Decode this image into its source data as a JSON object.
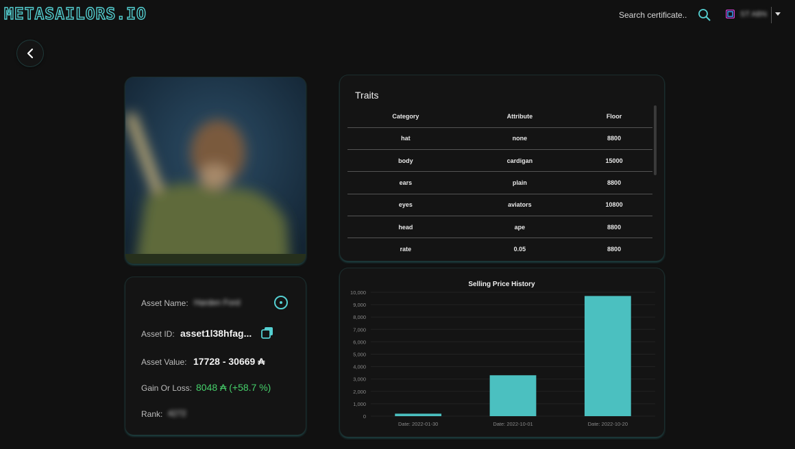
{
  "header": {
    "logo": "METASAILORS.IO",
    "search_placeholder": "Search certificate..",
    "wallet_name": "ST ABN"
  },
  "asset": {
    "name_label": "Asset Name:",
    "name_value": "Harden Ford",
    "id_label": "Asset ID:",
    "id_value": "asset1l38hfag...",
    "value_label": "Asset Value:",
    "value_value": "17728 - 30669 ₳",
    "gain_label": "Gain Or Loss:",
    "gain_value": "8048 ₳ (+58.7 %)",
    "rank_label": "Rank:",
    "rank_value": "4272"
  },
  "traits": {
    "title": "Traits",
    "columns": [
      "Category",
      "Attribute",
      "Floor"
    ],
    "rows": [
      [
        "hat",
        "none",
        "8800"
      ],
      [
        "body",
        "cardigan",
        "15000"
      ],
      [
        "ears",
        "plain",
        "8800"
      ],
      [
        "eyes",
        "aviators",
        "10800"
      ],
      [
        "head",
        "ape",
        "8800"
      ],
      [
        "rate",
        "0.05",
        "8800"
      ]
    ]
  },
  "chart_data": {
    "type": "bar",
    "title": "Selling Price History",
    "categories": [
      "Date: 2022-01-30",
      "Date: 2022-10-01",
      "Date: 2022-10-20"
    ],
    "values": [
      200,
      3300,
      9700
    ],
    "ylim": [
      0,
      10000
    ],
    "yticks": [
      "0",
      "1,000",
      "2,000",
      "3,000",
      "4,000",
      "5,000",
      "6,000",
      "7,000",
      "8,000",
      "9,000",
      "10,000"
    ],
    "bar_color": "#4bc0c0",
    "grid": true
  },
  "colors": {
    "accent": "#55d0d2",
    "positive": "#46d16b",
    "bar": "#4bc0c0"
  }
}
